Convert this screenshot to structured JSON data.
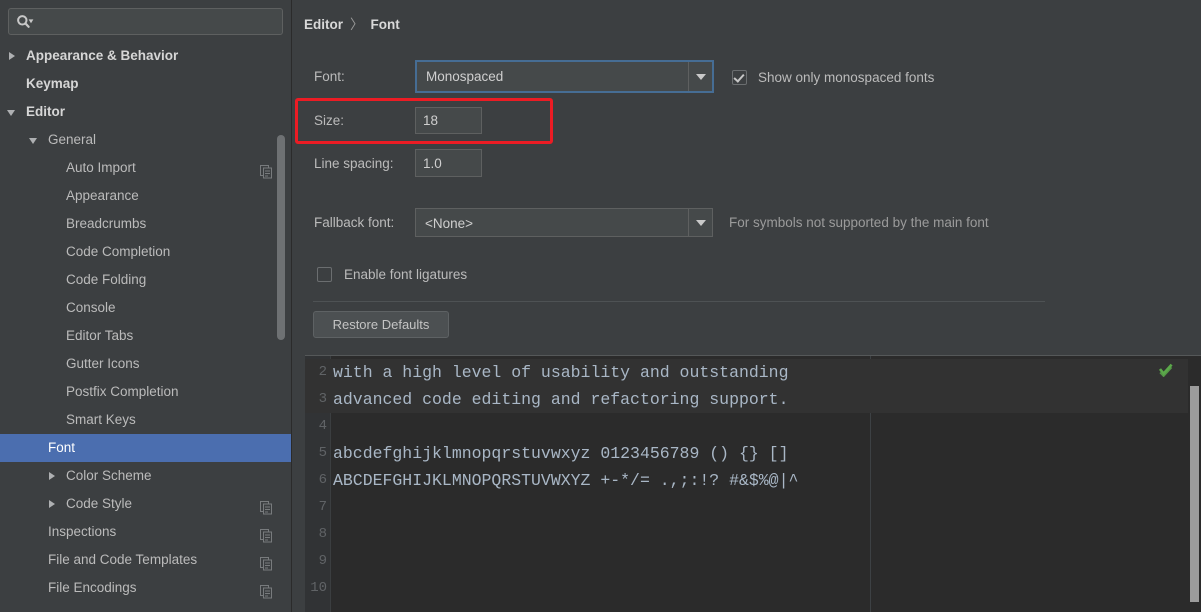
{
  "search": {
    "placeholder": "",
    "value": "",
    "icon": "search-icon"
  },
  "sidebar": {
    "items": [
      {
        "label": "Appearance & Behavior",
        "indent": 8,
        "twisty": "closed",
        "bold": true,
        "selected": false,
        "copy": false
      },
      {
        "label": "Keymap",
        "indent": 26,
        "twisty": "none",
        "bold": true,
        "selected": false,
        "copy": false
      },
      {
        "label": "Editor",
        "indent": 8,
        "twisty": "open",
        "bold": true,
        "selected": false,
        "copy": false
      },
      {
        "label": "General",
        "indent": 30,
        "twisty": "open",
        "bold": false,
        "selected": false,
        "copy": false
      },
      {
        "label": "Auto Import",
        "indent": 66,
        "twisty": "none",
        "bold": false,
        "selected": false,
        "copy": true
      },
      {
        "label": "Appearance",
        "indent": 66,
        "twisty": "none",
        "bold": false,
        "selected": false,
        "copy": false
      },
      {
        "label": "Breadcrumbs",
        "indent": 66,
        "twisty": "none",
        "bold": false,
        "selected": false,
        "copy": false
      },
      {
        "label": "Code Completion",
        "indent": 66,
        "twisty": "none",
        "bold": false,
        "selected": false,
        "copy": false
      },
      {
        "label": "Code Folding",
        "indent": 66,
        "twisty": "none",
        "bold": false,
        "selected": false,
        "copy": false
      },
      {
        "label": "Console",
        "indent": 66,
        "twisty": "none",
        "bold": false,
        "selected": false,
        "copy": false
      },
      {
        "label": "Editor Tabs",
        "indent": 66,
        "twisty": "none",
        "bold": false,
        "selected": false,
        "copy": false
      },
      {
        "label": "Gutter Icons",
        "indent": 66,
        "twisty": "none",
        "bold": false,
        "selected": false,
        "copy": false
      },
      {
        "label": "Postfix Completion",
        "indent": 66,
        "twisty": "none",
        "bold": false,
        "selected": false,
        "copy": false
      },
      {
        "label": "Smart Keys",
        "indent": 66,
        "twisty": "none",
        "bold": false,
        "selected": false,
        "copy": false
      },
      {
        "label": "Font",
        "indent": 48,
        "twisty": "none",
        "bold": false,
        "selected": true,
        "copy": false
      },
      {
        "label": "Color Scheme",
        "indent": 48,
        "twisty": "closed",
        "bold": false,
        "selected": false,
        "copy": false
      },
      {
        "label": "Code Style",
        "indent": 48,
        "twisty": "closed",
        "bold": false,
        "selected": false,
        "copy": true
      },
      {
        "label": "Inspections",
        "indent": 48,
        "twisty": "none",
        "bold": false,
        "selected": false,
        "copy": true
      },
      {
        "label": "File and Code Templates",
        "indent": 48,
        "twisty": "none",
        "bold": false,
        "selected": false,
        "copy": true
      },
      {
        "label": "File Encodings",
        "indent": 48,
        "twisty": "none",
        "bold": false,
        "selected": false,
        "copy": true
      }
    ]
  },
  "breadcrumb": {
    "parent": "Editor",
    "separator": "〉",
    "current": "Font"
  },
  "form": {
    "font_label": "Font:",
    "font_value": "Monospaced",
    "show_mono_label": "Show only monospaced fonts",
    "show_mono_checked": true,
    "size_label": "Size:",
    "size_value": "18",
    "line_spacing_label": "Line spacing:",
    "line_spacing_value": "1.0",
    "fallback_label": "Fallback font:",
    "fallback_value": "<None>",
    "fallback_hint": "For symbols not supported by the main font",
    "ligatures_label": "Enable font ligatures",
    "ligatures_checked": false,
    "restore_defaults_label": "Restore Defaults"
  },
  "preview": {
    "lines": [
      {
        "num": "2",
        "text": "with a high level of usability and outstanding",
        "highlight": true
      },
      {
        "num": "3",
        "text": "advanced code editing and refactoring support.",
        "highlight": true
      },
      {
        "num": "4",
        "text": "",
        "highlight": false
      },
      {
        "num": "5",
        "text": "abcdefghijklmnopqrstuvwxyz 0123456789 () {} []",
        "highlight": false
      },
      {
        "num": "6",
        "text": "ABCDEFGHIJKLMNOPQRSTUVWXYZ +-*/= .,;:!? #&$%@|^",
        "highlight": false
      },
      {
        "num": "7",
        "text": "",
        "highlight": false
      },
      {
        "num": "8",
        "text": "",
        "highlight": false
      },
      {
        "num": "9",
        "text": "",
        "highlight": false
      },
      {
        "num": "10",
        "text": "",
        "highlight": false
      }
    ],
    "status_icon": "green-check-icon"
  },
  "colors": {
    "background": "#3c3f41",
    "selection": "#4b6eaf",
    "focus_border": "#466d94",
    "annotation": "#ec1c24",
    "editor_background": "#2b2b2b",
    "code_text": "#a9b7c6",
    "ok_green": "#58a84b"
  }
}
